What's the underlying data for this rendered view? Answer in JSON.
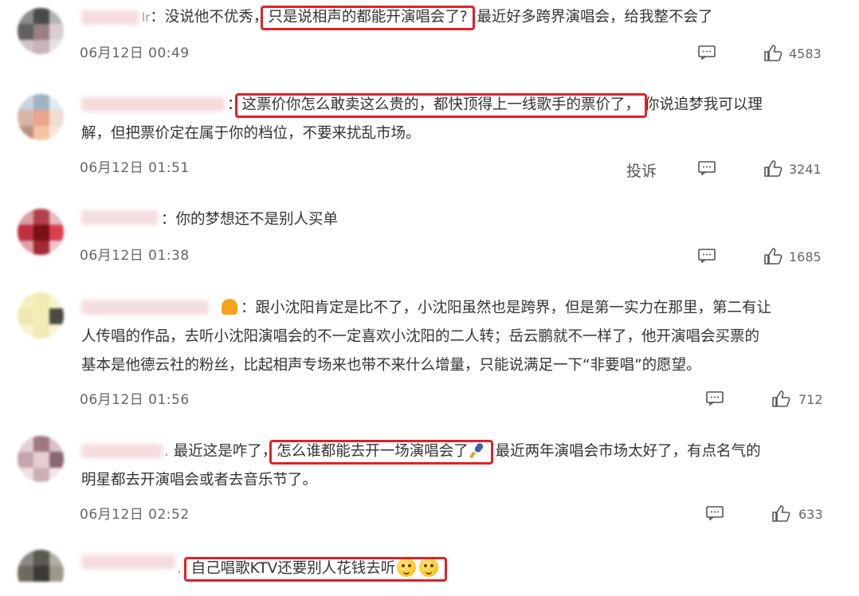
{
  "comments": [
    {
      "username_suffix": "lr",
      "pre": "：没说他不优秀，",
      "highlight": "只是说相声的都能开演唱会了?",
      "post": "最近好多跨界演唱会，给我整不会了",
      "date": "06月12日 00:49",
      "likes": "4583"
    },
    {
      "username_suffix": "",
      "pre": "：",
      "highlight": "这票价你怎么敢卖这么贵的，都快顶得上一线歌手的票价了，",
      "post": "你说追梦我可以理",
      "line2": "解，但把票价定在属于你的档位，不要来扰乱市场。",
      "date": "06月12日 01:51",
      "report": "投诉",
      "likes": "3241"
    },
    {
      "username_suffix": "",
      "pre": "：你的梦想还不是别人买单",
      "date": "06月12日 01:38",
      "likes": "1685"
    },
    {
      "username_suffix": "",
      "pre": "：跟小沈阳肯定是比不了，小沈阳虽然也是跨界，但是第一实力在那里，第二有让",
      "line2": "人传唱的作品，去听小沈阳演唱会的不一定喜欢小沈阳的二人转；岳云鹏就不一样了，他开演唱会买票的",
      "line3": "基本是他德云社的粉丝，比起相声专场来也带不来什么增量，只能说满足一下“非要唱”的愿望。",
      "date": "06月12日 01:56",
      "likes": "712"
    },
    {
      "username_suffix": ".",
      "pre": "最近这是咋了，",
      "highlight": "怎么谁都能去开一场演唱会了",
      "post": "最近两年演唱会市场太好了，有点名气的",
      "line2": "明星都去开演唱会或者去音乐节了。",
      "date": "06月12日 02:52",
      "likes": "633"
    },
    {
      "username_suffix": ".",
      "highlight": "自己唱歌KTV还要别人花钱去听"
    }
  ],
  "icons": {
    "reply": "comment-icon",
    "like": "thumbs-up-icon"
  },
  "colors": {
    "highlight_border": "#e0202a",
    "text": "#333333",
    "meta": "#666666"
  }
}
